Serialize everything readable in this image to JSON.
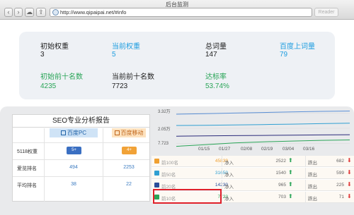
{
  "window": {
    "title": "后台监测",
    "url": "http://www.qipaipai.net/#info",
    "reader_label": "Reader"
  },
  "summary": {
    "initial_weight_label": "初始权重",
    "initial_weight_value": "3",
    "current_weight_label": "当前权重",
    "current_weight_value": "5",
    "total_words_label": "总词量",
    "total_words_value": "147",
    "baidu_words_label": "百度上词量",
    "baidu_words_value": "79",
    "initial_top10_label": "初始前十名数",
    "initial_top10_value": "4235",
    "current_top10_label": "当前前十名数",
    "current_top10_value": "7723",
    "rate_label": "达标率",
    "rate_value": "53.74%"
  },
  "seo_report": {
    "title": "SEO专业分析报告",
    "col_pc": "百度PC",
    "col_mobile": "百度移动",
    "rows": [
      {
        "label": "5118权重",
        "pc": "5+",
        "mobile": "4+"
      },
      {
        "label": "爱览排名",
        "pc": "494",
        "mobile": "2253"
      },
      {
        "label": "平均排名",
        "pc": "38",
        "mobile": "22"
      }
    ]
  },
  "chart_data": {
    "type": "line",
    "y_ticks": [
      "3.32万",
      "2.05万",
      "7.723"
    ],
    "x_ticks": [
      "01/15",
      "01/27",
      "02/08",
      "02/19",
      "03/04",
      "03/16"
    ],
    "series": [
      {
        "color": "#5a8fd6",
        "values": [
          3.0,
          3.05,
          3.1,
          3.15,
          3.2,
          3.25,
          3.28
        ]
      },
      {
        "color": "#2f9fd2",
        "values": [
          2.0,
          2.02,
          2.05,
          2.08,
          2.12,
          2.16,
          2.2
        ]
      },
      {
        "color": "#2a2a7a",
        "values": [
          1.05,
          1.08,
          1.1,
          1.12,
          1.14,
          1.16,
          1.18
        ]
      },
      {
        "color": "#2aa558",
        "values": [
          0.15,
          0.3,
          0.45,
          0.55,
          0.62,
          0.68,
          0.72
        ]
      }
    ]
  },
  "rank_table": {
    "in_label": "净入",
    "out_label": "跌出",
    "rows": [
      {
        "name": "前100名",
        "value": "45839",
        "in": "2522",
        "out": "682",
        "color": "#f0a030"
      },
      {
        "name": "前50名",
        "value": "31650",
        "in": "1540",
        "out": "599",
        "color": "#2f9fd2"
      },
      {
        "name": "前20名",
        "value": "14230",
        "in": "965",
        "out": "225",
        "color": "#2a4e9a"
      },
      {
        "name": "前10名",
        "value": "7723",
        "in": "703",
        "out": "71",
        "color": "#2aa558"
      }
    ]
  }
}
